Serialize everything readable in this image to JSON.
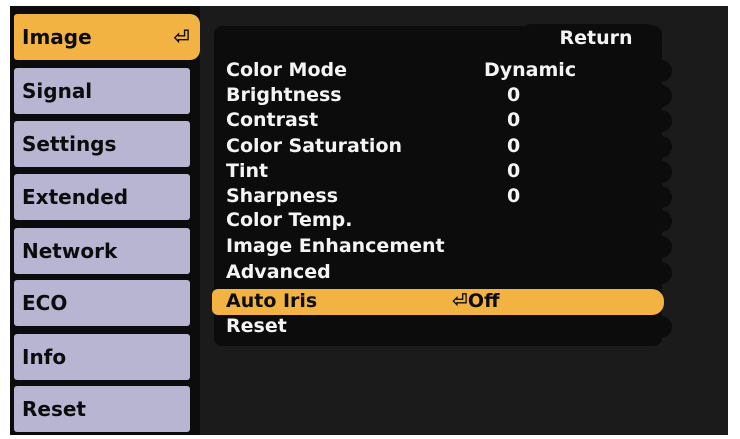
{
  "sidebar": {
    "items": [
      {
        "label": "Image",
        "active": true
      },
      {
        "label": "Signal"
      },
      {
        "label": "Settings"
      },
      {
        "label": "Extended"
      },
      {
        "label": "Network"
      },
      {
        "label": "ECO"
      },
      {
        "label": "Info"
      },
      {
        "label": "Reset"
      }
    ],
    "enter_glyph": "⏎"
  },
  "menu": {
    "return_label": "Return",
    "rows": [
      {
        "label": "Color Mode",
        "value": "Dynamic"
      },
      {
        "label": "Brightness",
        "value": "0"
      },
      {
        "label": "Contrast",
        "value": "0"
      },
      {
        "label": "Color Saturation",
        "value": "0"
      },
      {
        "label": "Tint",
        "value": "0"
      },
      {
        "label": "Sharpness",
        "value": "0"
      },
      {
        "label": "Color Temp.",
        "value": ""
      },
      {
        "label": "Image Enhancement",
        "value": ""
      },
      {
        "label": "Advanced",
        "value": ""
      },
      {
        "label": "Auto Iris",
        "value": "⏎Off",
        "highlighted": true
      },
      {
        "label": "Reset",
        "value": ""
      }
    ]
  },
  "colors": {
    "accent": "#f3b342",
    "tab": "#b8b5d3",
    "background": "#0c0c0c",
    "text": "#f4f4f4"
  }
}
